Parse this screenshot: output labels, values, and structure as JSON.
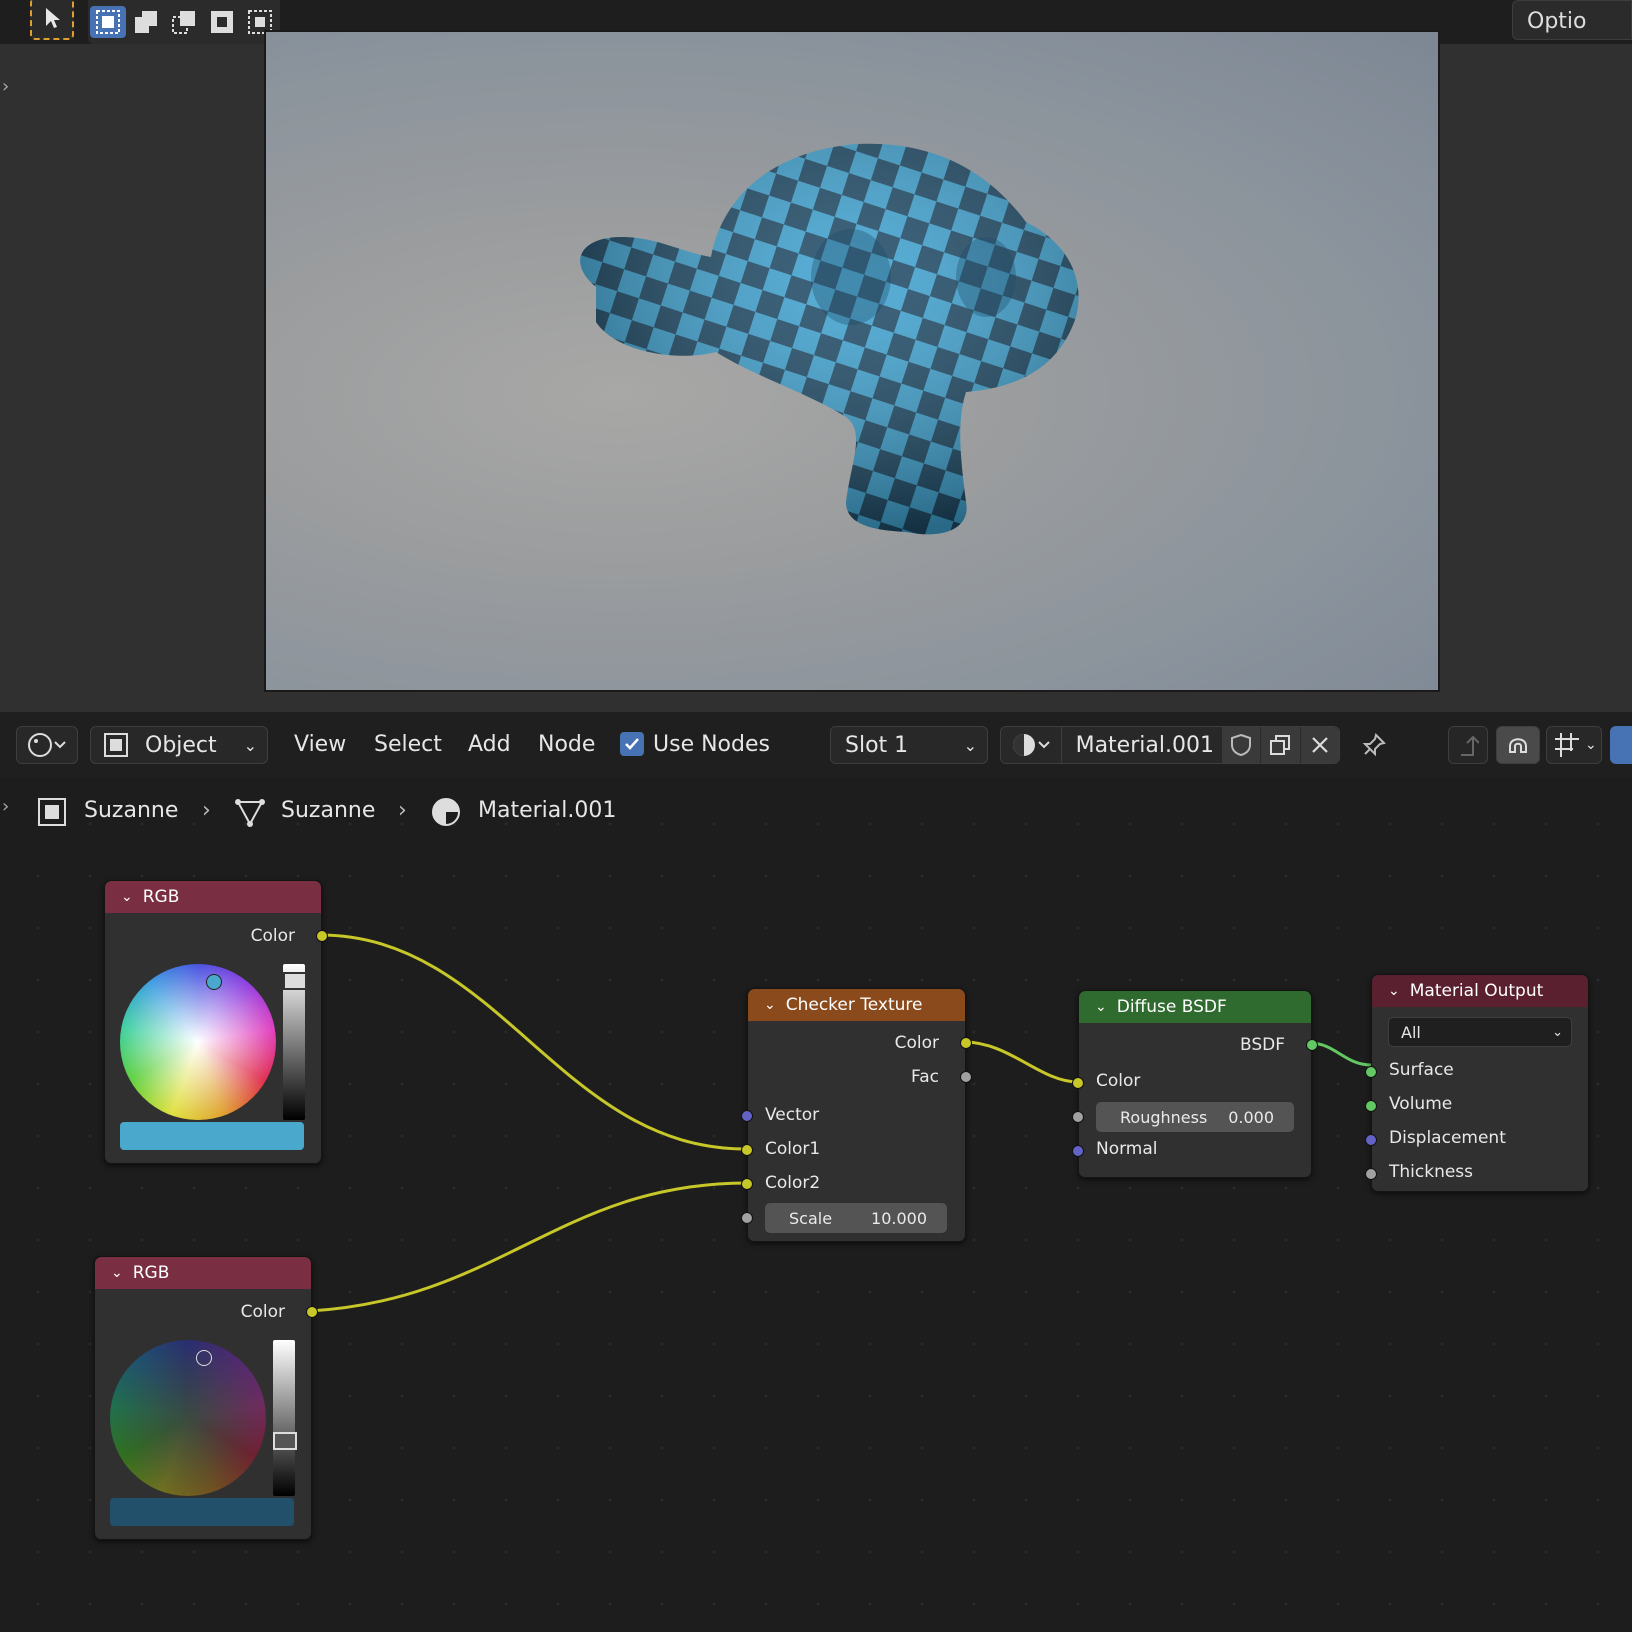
{
  "topbar": {
    "options_label": "Optio"
  },
  "header": {
    "mode": "Object",
    "menus": [
      "View",
      "Select",
      "Add",
      "Node"
    ],
    "use_nodes_label": "Use Nodes",
    "use_nodes_checked": true,
    "slot": "Slot 1",
    "material": "Material.001"
  },
  "breadcrumb": {
    "object": "Suzanne",
    "mesh": "Suzanne",
    "material": "Material.001"
  },
  "nodes": {
    "rgb1": {
      "title": "RGB",
      "output": "Color",
      "color_swatch": "#4aa8cc"
    },
    "rgb2": {
      "title": "RGB",
      "output": "Color",
      "color_swatch": "#22506a"
    },
    "checker": {
      "title": "Checker Texture",
      "outputs": [
        "Color",
        "Fac"
      ],
      "inputs": [
        "Vector",
        "Color1",
        "Color2"
      ],
      "scale_label": "Scale",
      "scale_value": "10.000"
    },
    "diffuse": {
      "title": "Diffuse BSDF",
      "output": "BSDF",
      "inputs": [
        "Color",
        "Normal"
      ],
      "roughness_label": "Roughness",
      "roughness_value": "0.000"
    },
    "output": {
      "title": "Material Output",
      "target": "All",
      "inputs": [
        "Surface",
        "Volume",
        "Displacement",
        "Thickness"
      ]
    }
  },
  "colors": {
    "rgb_header": "#7a2e42",
    "checker_header": "#8a4a1c",
    "diffuse_header": "#2f6b2f",
    "output_header": "#5a2030",
    "link_yellow": "#c7c729",
    "link_green": "#63c763",
    "accent": "#4772b3"
  }
}
